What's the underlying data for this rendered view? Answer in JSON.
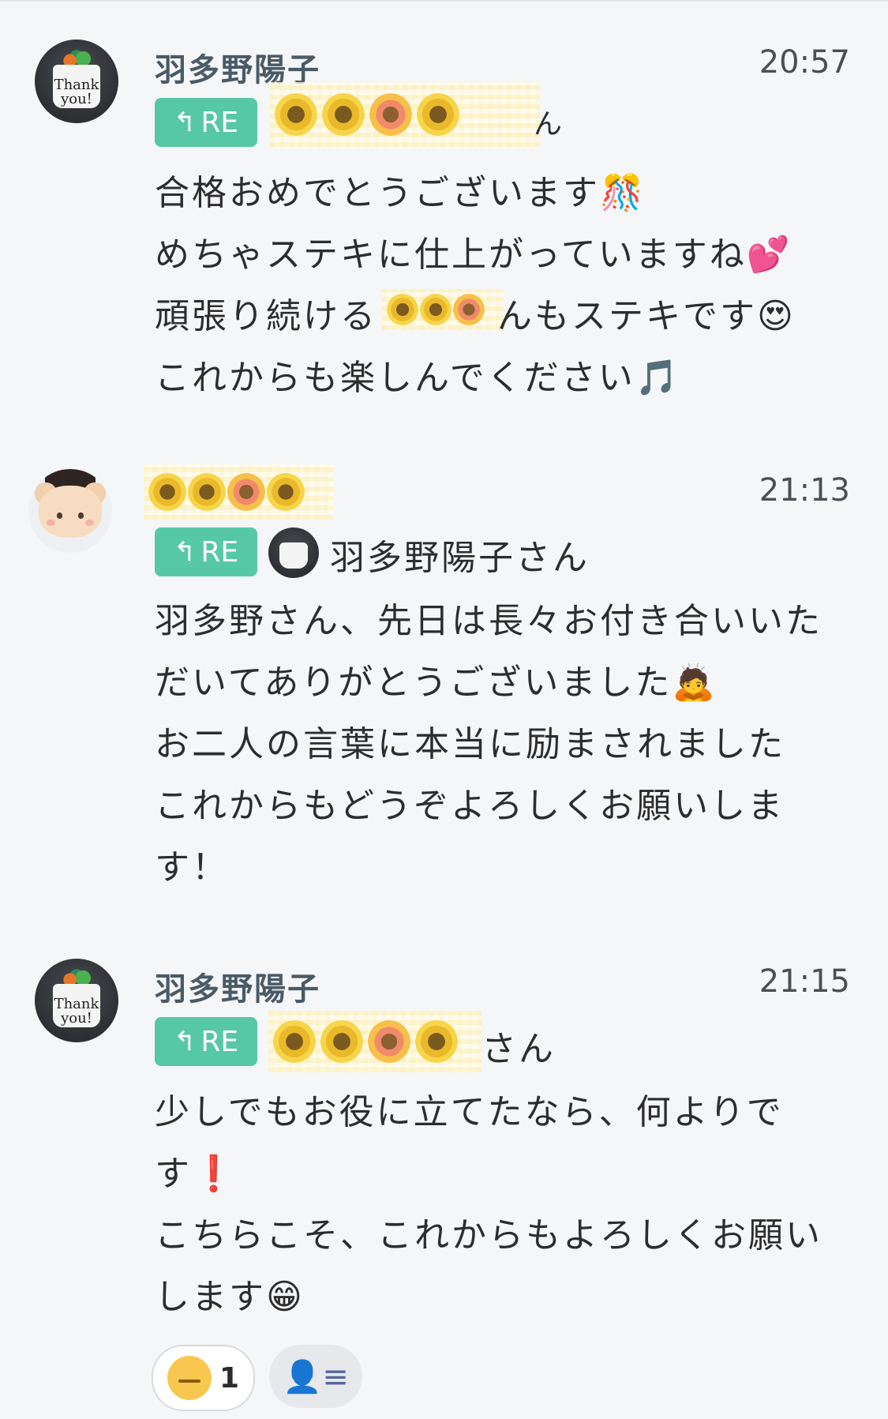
{
  "messages": [
    {
      "sender": "羽多野陽子",
      "time": "20:57",
      "re_label": "RE",
      "reply_tail": "ん",
      "lines": [
        "合格おめでとうございます🎊",
        "めちゃステキに仕上がっていますね💕",
        "頑張り続ける",
        "これからも楽しんでください🎵"
      ],
      "line3_tail": "んもステキです😍"
    },
    {
      "sender": "",
      "time": "21:13",
      "re_label": "RE",
      "reply_name": "羽多野陽子さん",
      "lines": [
        "羽多野さん、先日は長々お付き合いいた",
        "だいてありがとうございました🙇",
        "お二人の言葉に本当に励まされました",
        "これからもどうぞよろしくお願いしま",
        "す！"
      ]
    },
    {
      "sender": "羽多野陽子",
      "time": "21:15",
      "re_label": "RE",
      "reply_tail": "さん",
      "lines": [
        "少しでもお役に立てたなら、何よりで",
        "す❗",
        "こちらこそ、これからもよろしくお願い",
        "します😁"
      ]
    }
  ],
  "reactions": {
    "count": "1",
    "member_icon": "member-list-icon"
  },
  "avatars": {
    "cup_text": "Thank you!"
  },
  "colors": {
    "accent_green": "#56c8a4",
    "background": "#f5f6f8"
  }
}
